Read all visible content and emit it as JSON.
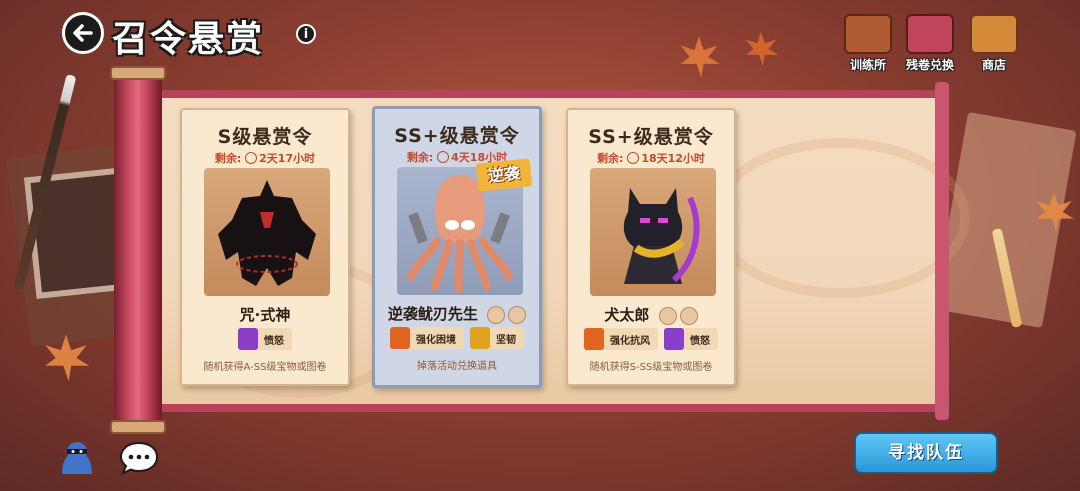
{
  "header": {
    "title": "召令悬赏",
    "info_glyph": "i"
  },
  "nav": [
    {
      "label": "训练所",
      "icon": "training-icon"
    },
    {
      "label": "残卷兑换",
      "icon": "scroll-exchange-icon"
    },
    {
      "label": "商店",
      "icon": "shop-icon"
    }
  ],
  "cards": [
    {
      "title": "S级悬赏令",
      "remain_label": "剩余:",
      "remain_time": "2天17小时",
      "name": "咒·式神",
      "traits": [
        {
          "label": "愤怒",
          "color": "#8b3fc9"
        }
      ],
      "reward": "随机获得A-SS级宝物或图卷"
    },
    {
      "title": "SS+级悬赏令",
      "remain_label": "剩余:",
      "remain_time": "4天18小时",
      "badge": "逆袭",
      "name": "逆袭鱿刃先生",
      "traits": [
        {
          "label": "强化困境",
          "color": "#e0651f"
        },
        {
          "label": "坚韧",
          "color": "#e0a21f"
        }
      ],
      "reward": "掉落活动兑换道具"
    },
    {
      "title": "SS+级悬赏令",
      "remain_label": "剩余:",
      "remain_time": "18天12小时",
      "name": "犬太郎",
      "traits": [
        {
          "label": "强化抗风",
          "color": "#e0651f"
        },
        {
          "label": "愤怒",
          "color": "#8b3fc9"
        }
      ],
      "reward": "随机获得S-SS级宝物或图卷"
    }
  ],
  "footer": {
    "find_team_label": "寻找队伍"
  },
  "colors": {
    "accent_blue": "#2a97da",
    "scroll_red": "#b7435b",
    "remain_red": "#c54a2a"
  }
}
